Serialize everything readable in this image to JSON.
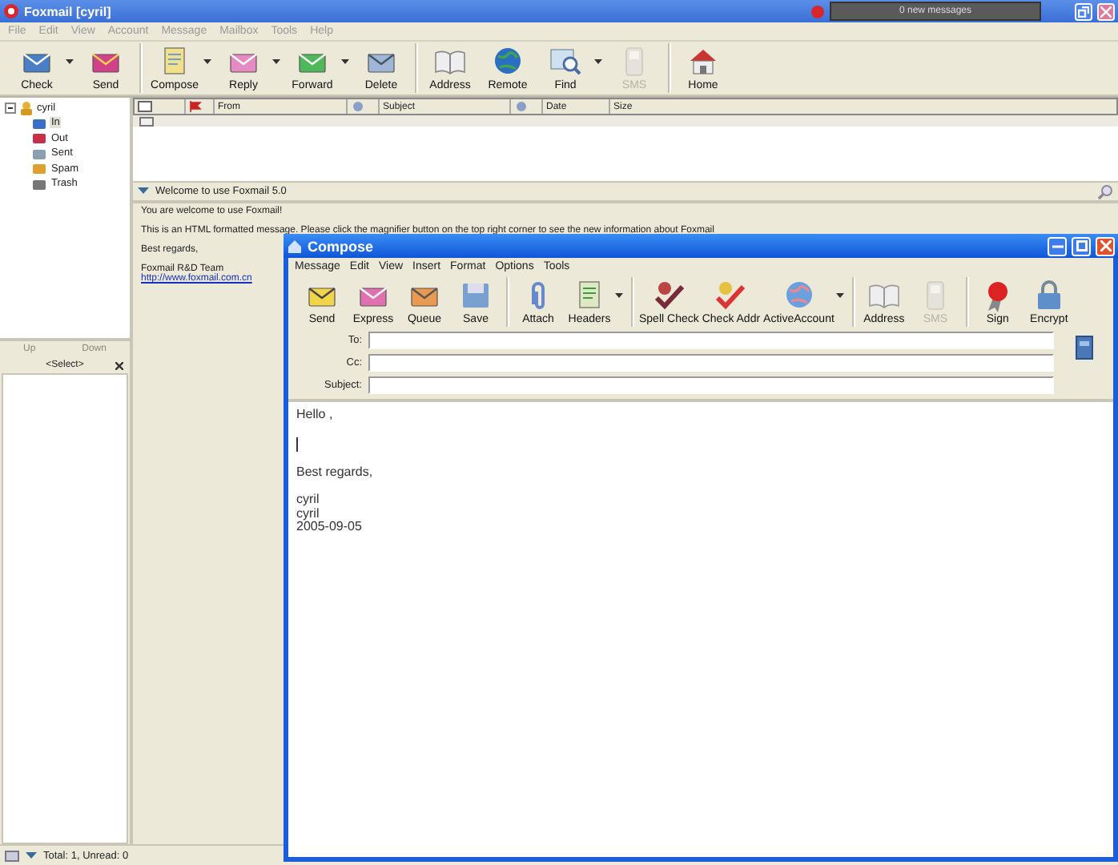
{
  "window": {
    "title": "Foxmail [cyril]",
    "notification": "0 new messages"
  },
  "menu": [
    "File",
    "Edit",
    "View",
    "Account",
    "Message",
    "Mailbox",
    "Tools",
    "Help"
  ],
  "toolbar": {
    "groups": [
      [
        {
          "label": "Check",
          "dropdown": true,
          "disabled": false
        },
        {
          "label": "Send",
          "dropdown": false,
          "disabled": false
        }
      ],
      [
        {
          "label": "Compose",
          "dropdown": true,
          "disabled": false
        },
        {
          "label": "Reply",
          "dropdown": true,
          "disabled": false
        },
        {
          "label": "Forward",
          "dropdown": true,
          "disabled": false
        },
        {
          "label": "Delete",
          "dropdown": false,
          "disabled": false
        }
      ],
      [
        {
          "label": "Address",
          "dropdown": false,
          "disabled": false
        },
        {
          "label": "Remote",
          "dropdown": false,
          "disabled": false
        },
        {
          "label": "Find",
          "dropdown": true,
          "disabled": false
        },
        {
          "label": "SMS",
          "dropdown": false,
          "disabled": true
        }
      ],
      [
        {
          "label": "Home",
          "dropdown": false,
          "disabled": false
        }
      ]
    ]
  },
  "folders": {
    "account": "cyril",
    "expanded": true,
    "children": [
      {
        "label": "In",
        "selected": true
      },
      {
        "label": "Out",
        "selected": false
      },
      {
        "label": "Sent",
        "selected": false
      },
      {
        "label": "Spam",
        "selected": false
      },
      {
        "label": "Trash",
        "selected": false
      }
    ]
  },
  "folder_nav": {
    "up": {
      "label": "Up",
      "disabled": true
    },
    "down": {
      "label": "Down",
      "disabled": true
    },
    "select": "<Select>"
  },
  "message_list": {
    "columns": [
      "From",
      "Subject",
      "Date",
      "Size"
    ],
    "rows": [
      {
        "selected": true
      }
    ]
  },
  "preview": {
    "title": "Welcome to use Foxmail 5.0",
    "paragraphs": [
      "You are welcome to use Foxmail!",
      "This is an HTML formatted message. Please click the magnifier button on the top right corner to see the new information about Foxmail",
      "Best regards,",
      "Foxmail R&D Team"
    ],
    "link": "http://www.foxmail.com.cn"
  },
  "status_bar": {
    "text": "Total: 1, Unread: 0"
  },
  "compose": {
    "title": "Compose",
    "menu": [
      "Message",
      "Edit",
      "View",
      "Insert",
      "Format",
      "Options",
      "Tools"
    ],
    "toolbar": {
      "groups": [
        [
          {
            "label": "Send",
            "dropdown": false,
            "disabled": false
          },
          {
            "label": "Express",
            "dropdown": false,
            "disabled": false
          },
          {
            "label": "Queue",
            "dropdown": false,
            "disabled": false
          },
          {
            "label": "Save",
            "dropdown": false,
            "disabled": false
          }
        ],
        [
          {
            "label": "Attach",
            "dropdown": false,
            "disabled": false
          },
          {
            "label": "Headers",
            "dropdown": true,
            "disabled": false
          }
        ],
        [
          {
            "label": "Spell Check",
            "dropdown": false,
            "disabled": false
          },
          {
            "label": "Check Addr",
            "dropdown": false,
            "disabled": false
          },
          {
            "label": "ActiveAccount",
            "dropdown": true,
            "disabled": false
          }
        ],
        [
          {
            "label": "Address",
            "dropdown": false,
            "disabled": false
          },
          {
            "label": "SMS",
            "dropdown": false,
            "disabled": true
          }
        ],
        [
          {
            "label": "Sign",
            "dropdown": false,
            "disabled": false
          },
          {
            "label": "Encrypt",
            "dropdown": false,
            "disabled": false
          }
        ]
      ]
    },
    "fields": [
      {
        "label": "To:"
      },
      {
        "label": "Cc:"
      },
      {
        "label": "Subject:"
      }
    ],
    "body": [
      {
        "kind": "text",
        "lines": [
          "Hello ,"
        ]
      },
      {
        "kind": "cursor"
      },
      {
        "kind": "text",
        "lines": [
          "Best regards,"
        ]
      },
      {
        "kind": "text",
        "lines": [
          "cyril",
          "cyril",
          "2005-09-05"
        ]
      }
    ]
  }
}
